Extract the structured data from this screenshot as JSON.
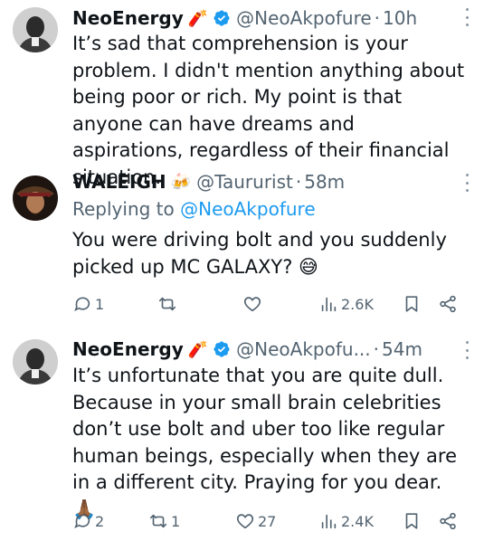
{
  "tweets": [
    {
      "name": "NeoEnergy",
      "name_emoji": "🧨",
      "handle": "@NeoAkpofure",
      "time": "10h",
      "text": "It’s sad that comprehension is your problem. I didn't mention anything about being poor or rich. My point is that anyone can have dreams and aspirations, regardless of their financial situation."
    },
    {
      "name": "WALEIGH",
      "name_emoji": "🍻",
      "handle": "@Taururist",
      "time": "58m",
      "replying_to_label": "Replying to",
      "replying_to_handle": "@NeoAkpofure",
      "text": "You were driving bolt and you suddenly picked up MC GALAXY? 😅",
      "stats": {
        "replies": "1",
        "reposts": "",
        "likes": "",
        "views": "2.6K"
      }
    },
    {
      "name": "NeoEnergy",
      "name_emoji": "🧨",
      "handle": "@NeoAkpofu...",
      "time": "54m",
      "text": "It’s unfortunate that you are quite dull. Because in your small brain celebrities don’t use bolt and uber too like regular human beings, especially when they are in a different city. Praying for you dear. 🙏🏾",
      "stats": {
        "replies": "2",
        "reposts": "1",
        "likes": "27",
        "views": "2.4K"
      }
    }
  ],
  "colors": {
    "verified": "#1d9bf0",
    "mention": "#1d9bf0",
    "muted": "#536471",
    "text": "#0f1419"
  }
}
